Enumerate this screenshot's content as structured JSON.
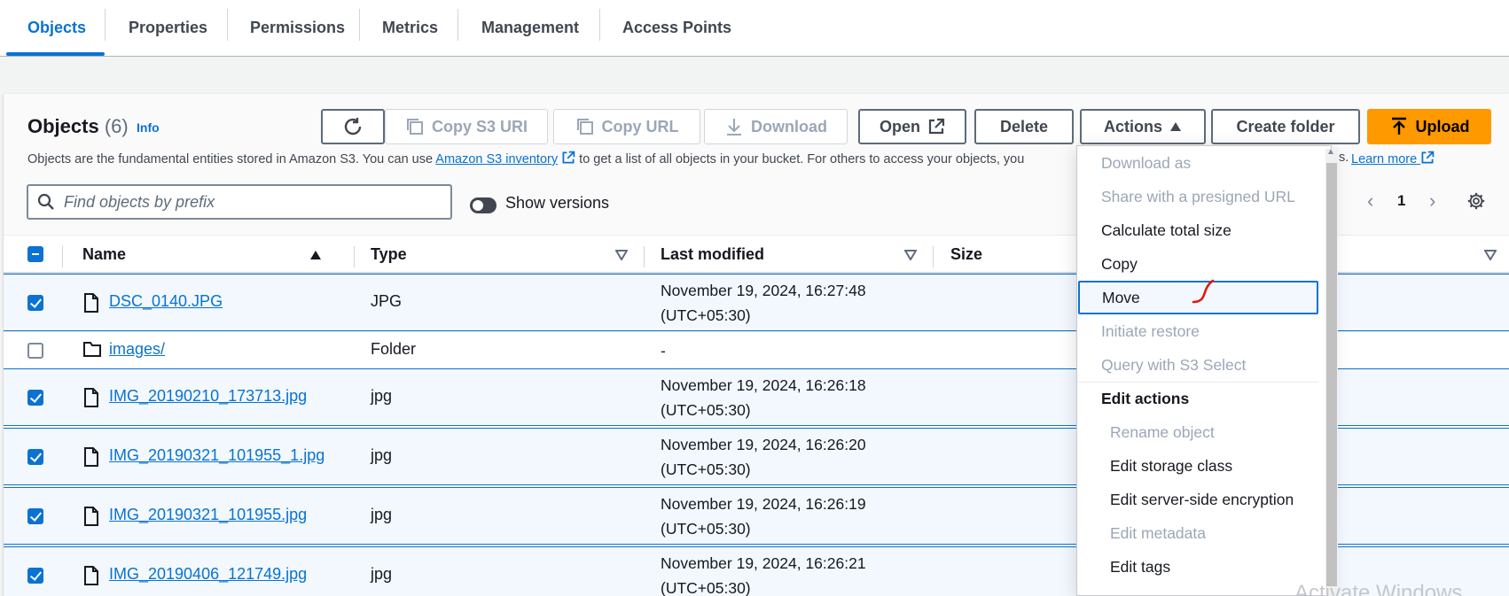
{
  "tabs": [
    {
      "label": "Objects"
    },
    {
      "label": "Properties"
    },
    {
      "label": "Permissions"
    },
    {
      "label": "Metrics"
    },
    {
      "label": "Management"
    },
    {
      "label": "Access Points"
    }
  ],
  "header": {
    "title": "Objects",
    "count": "(6)",
    "info": "Info",
    "desc_prefix": "Objects are the fundamental entities stored in Amazon S3. You can use ",
    "desc_link": "Amazon S3 inventory",
    "desc_suffix": " to get a list of all objects in your bucket. For others to access your objects, you",
    "desc_tail": "s.",
    "learn_more": "Learn more"
  },
  "toolbar": {
    "copy_s3_uri": "Copy S3 URI",
    "copy_url": "Copy URL",
    "download": "Download",
    "open": "Open",
    "delete": "Delete",
    "actions": "Actions",
    "create_folder": "Create folder",
    "upload": "Upload"
  },
  "search": {
    "placeholder": "Find objects by prefix"
  },
  "versions_label": "Show versions",
  "pagination": {
    "page": "1"
  },
  "columns": {
    "name": "Name",
    "type": "Type",
    "modified": "Last modified",
    "size": "Size"
  },
  "rows": [
    {
      "name": "DSC_0140.JPG",
      "type": "JPG",
      "modified_date": "November 19, 2024, 16:27:48",
      "modified_tz": "(UTC+05:30)",
      "checked": true
    },
    {
      "name": "images/",
      "type": "Folder",
      "modified_date": "-",
      "modified_tz": "",
      "checked": false
    },
    {
      "name": "IMG_20190210_173713.jpg",
      "type": "jpg",
      "modified_date": "November 19, 2024, 16:26:18",
      "modified_tz": "(UTC+05:30)",
      "checked": true
    },
    {
      "name": "IMG_20190321_101955_1.jpg",
      "type": "jpg",
      "modified_date": "November 19, 2024, 16:26:20",
      "modified_tz": "(UTC+05:30)",
      "checked": true
    },
    {
      "name": "IMG_20190321_101955.jpg",
      "type": "jpg",
      "modified_date": "November 19, 2024, 16:26:19",
      "modified_tz": "(UTC+05:30)",
      "checked": true
    },
    {
      "name": "IMG_20190406_121749.jpg",
      "type": "jpg",
      "modified_date": "November 19, 2024, 16:26:21",
      "modified_tz": "(UTC+05:30)",
      "checked": true
    }
  ],
  "actions_menu": {
    "download_as": "Download as",
    "share_presigned": "Share with a presigned URL",
    "calc_size": "Calculate total size",
    "copy": "Copy",
    "move": "Move",
    "initiate_restore": "Initiate restore",
    "query_select": "Query with S3 Select",
    "edit_actions": "Edit actions",
    "rename": "Rename object",
    "edit_storage": "Edit storage class",
    "edit_encryption": "Edit server-side encryption",
    "edit_metadata": "Edit metadata",
    "edit_tags": "Edit tags"
  },
  "watermark": "Activate Windows",
  "colors": {
    "accent": "#0972d3",
    "primary": "#ff9900",
    "annotation": "#e3170a"
  }
}
